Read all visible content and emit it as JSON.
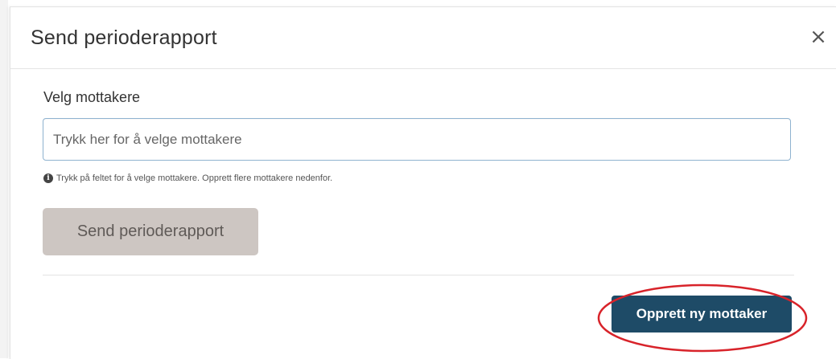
{
  "dialog": {
    "title": "Send perioderapport",
    "close_symbol": "×"
  },
  "recipients": {
    "label": "Velg mottakere",
    "placeholder": "Trykk her for å velge mottakere",
    "value": "",
    "help_icon": "info-circle-icon",
    "help_text": "Trykk på feltet for å velge mottakere. Opprett flere mottakere nedenfor."
  },
  "actions": {
    "send_label": "Send perioderapport",
    "send_disabled": true,
    "create_label": "Opprett ny mottaker"
  },
  "colors": {
    "primary": "#1e4b67",
    "disabled_button": "#cdc6c2",
    "annotation": "#d8232a"
  }
}
